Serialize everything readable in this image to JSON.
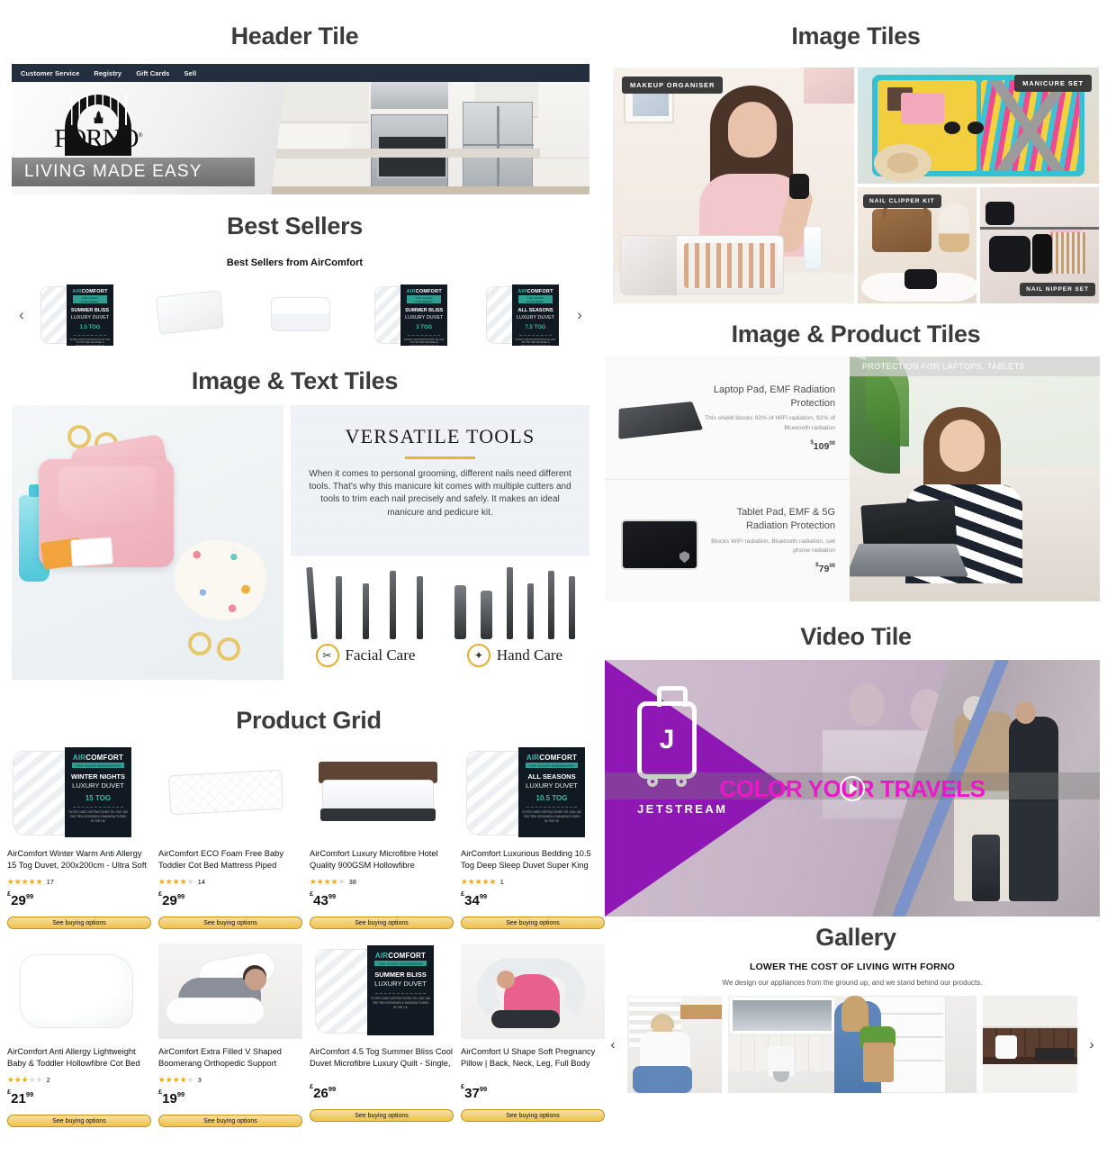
{
  "sections": {
    "header_tile": "Header Tile",
    "best_sellers": "Best Sellers",
    "image_text_tiles": "Image & Text Tiles",
    "product_grid": "Product Grid",
    "image_tiles": "Image Tiles",
    "image_product_tiles": "Image & Product Tiles",
    "video_tile": "Video Tile",
    "gallery": "Gallery"
  },
  "header": {
    "nav": [
      "Customer Service",
      "Registry",
      "Gift Cards",
      "Sell"
    ],
    "brand": "FORNO",
    "brand_mark": "®",
    "tagline": "LIVING MADE EASY"
  },
  "best_sellers": {
    "subtitle": "Best Sellers from AirComfort",
    "prev_arrow": "‹",
    "next_arrow": "›",
    "items": [
      {
        "kind": "duvet-box",
        "brand_a": "AIR",
        "brand_b": "COMFORT",
        "tagline": "THE SLEEP ENGINEERS",
        "name1": "SUMMER BLISS",
        "name2": "LUXURY DUVET",
        "tog": "1.5 TOG",
        "fine": "FILTER CARE INSTRUCTIONS\nTEL 0161 633 7587 RED\nDESIGNED & MANUFACTURED IN THE UK"
      },
      {
        "kind": "mattress"
      },
      {
        "kind": "pillow"
      },
      {
        "kind": "duvet-box",
        "brand_a": "AIR",
        "brand_b": "COMFORT",
        "tagline": "THE SLEEP ENGINEERS",
        "name1": "SUMMER BLISS",
        "name2": "LUXURY DUVET",
        "tog": "3 TOG",
        "fine": "FILTER CARE INSTRUCTIONS\nTEL 0161 633 7587 RED\nDESIGNED & MANUFACTURED IN THE UK"
      },
      {
        "kind": "duvet-box",
        "brand_a": "AIR",
        "brand_b": "COMFORT",
        "tagline": "THE SLEEP ENGINEERS",
        "name1": "ALL SEASONS",
        "name2": "LUXURY DUVET",
        "tog": "7.5 TOG",
        "fine": "FILTER CARE INSTRUCTIONS\nTEL 0161 633 7587 RED\nDESIGNED & MANUFACTURED IN THE UK"
      }
    ]
  },
  "image_text": {
    "title": "VERSATILE TOOLS",
    "body": "When it comes to personal grooming, different nails need different tools. That's why this manicure kit comes with multiple cutters and tools to trim each nail precisely and safely. It makes an ideal manicure and pedicure kit.",
    "badges": [
      {
        "label": "Facial Care",
        "icon": "tweezers-icon"
      },
      {
        "label": "Hand Care",
        "icon": "nail-file-icon"
      }
    ]
  },
  "product_grid": {
    "button_label": "See buying options",
    "products": [
      {
        "title": "AirComfort Winter Warm Anti Allergy 15 Tog Duvet, 200x200cm - Ultra Soft Microfibre...",
        "stars_full": 5,
        "reviews": "17",
        "currency": "£",
        "price_main": "29",
        "price_frac": "99",
        "img": "duvet-box",
        "box": {
          "brand_a": "AIR",
          "brand_b": "COMFORT",
          "tagline": "THE SLEEP ENGINEERS",
          "name1": "WINTER NIGHTS",
          "name2": "LUXURY DUVET",
          "tog": "15 TOG",
          "fine": "FILTER CARE INSTRUCTIONS\nTEL 0161 633 7587 RED\nDESIGNED & MANUFACTURED IN THE UK"
        }
      },
      {
        "title": "AirComfort ECO Foam Free Baby Toddler Cot Bed Mattress Piped Edges for Maximum...",
        "stars_full": 4,
        "reviews": "14",
        "currency": "£",
        "price_main": "29",
        "price_frac": "99",
        "img": "mattress"
      },
      {
        "title": "AirComfort Luxury Microfibre Hotel Quality 900GSM Hollowfibre Elasticated Corners &...",
        "stars_full": 4,
        "reviews": "38",
        "currency": "£",
        "price_main": "43",
        "price_frac": "99",
        "img": "bed"
      },
      {
        "title": "AirComfort Luxurious Bedding 10.5 Tog Deep Sleep Duvet Super King Size - All Season...",
        "stars_full": 5,
        "reviews": "1",
        "currency": "£",
        "price_main": "34",
        "price_frac": "99",
        "img": "duvet-box",
        "box": {
          "brand_a": "AIR",
          "brand_b": "COMFORT",
          "tagline": "THE SLEEP ENGINEERS",
          "name1": "ALL SEASONS",
          "name2": "LUXURY DUVET",
          "tog": "10.5 TOG",
          "fine": "FILTER CARE INSTRUCTIONS\nTEL 0161 633 7587 RED\nDESIGNED & MANUFACTURED IN THE UK"
        }
      },
      {
        "title": "AirComfort Anti Allergy Lightweight Baby & Toddler Hollowfibre Cot Bed Duvet & Pillow...",
        "stars_full": 3,
        "reviews": "2",
        "currency": "£",
        "price_main": "21",
        "price_frac": "99",
        "img": "white-duvet"
      },
      {
        "title": "AirComfort Extra Filled V Shaped Boomerang Orthopedic Support Pregnancy Maternity...",
        "stars_full": 4,
        "reviews": "3",
        "currency": "£",
        "price_main": "19",
        "price_frac": "99",
        "img": "person-pillow"
      },
      {
        "title": "AirComfort 4.5 Tog Summer Bliss Cool Duvet Microfibre Luxury Quilt - Single, Double,...",
        "stars_full": 0,
        "reviews": "",
        "currency": "£",
        "price_main": "26",
        "price_frac": "99",
        "img": "duvet-box",
        "box": {
          "brand_a": "AIR",
          "brand_b": "COMFORT",
          "tagline": "THE SLEEP ENGINEERS",
          "name1": "SUMMER BLISS",
          "name2": "LUXURY DUVET",
          "tog": "",
          "fine": "FILTER CARE INSTRUCTIONS\nTEL 0161 633 7587 RED\nDESIGNED & MANUFACTURED IN THE UK"
        }
      },
      {
        "title": "AirComfort U Shape Soft Pregnancy Pillow | Back, Neck, Leg, Full Body and Maternity...",
        "stars_full": 0,
        "reviews": "",
        "currency": "£",
        "price_main": "37",
        "price_frac": "99",
        "img": "u-pillow"
      }
    ]
  },
  "image_tiles": {
    "labels": [
      "MAKEUP ORGANISER",
      "MANICURE SET",
      "NAIL CLIPPER KIT",
      "NAIL NIPPER SET"
    ]
  },
  "image_product_tiles": {
    "banner": "PROTECTION FOR LAPTOPS, TABLETS",
    "products": [
      {
        "title": "Laptop Pad, EMF Radiation Protection",
        "desc": "This shield blocks 92% of WiFi radiation, 92% of Bluetooth radiation",
        "currency": "$",
        "price_main": "109",
        "price_frac": "00"
      },
      {
        "title": "Tablet Pad, EMF & 5G Radiation Protection",
        "desc": "Blocks WiFi radiation, Bluetooth radiation, cell phone radiation",
        "currency": "$",
        "price_main": "79",
        "price_frac": "00"
      }
    ]
  },
  "video": {
    "brand": "JETSTREAM",
    "brand_initial": "J",
    "headline": "COLOR YOUR TRAVELS",
    "play_icon": "play-icon"
  },
  "gallery": {
    "heading": "LOWER THE COST OF LIVING WITH FORNO",
    "subheading": "We design our appliances from the ground up, and we stand behind our products.",
    "prev_arrow": "‹",
    "next_arrow": "›"
  },
  "colors": {
    "nav_bar": "#232f3e",
    "amazon_button": "#f0c14b",
    "star": "#f0a223",
    "accent_teal": "#3fb6a8",
    "video_purple": "#8f17b3",
    "video_pink": "#ea18c8",
    "label_dark": "#3b3b3b"
  }
}
